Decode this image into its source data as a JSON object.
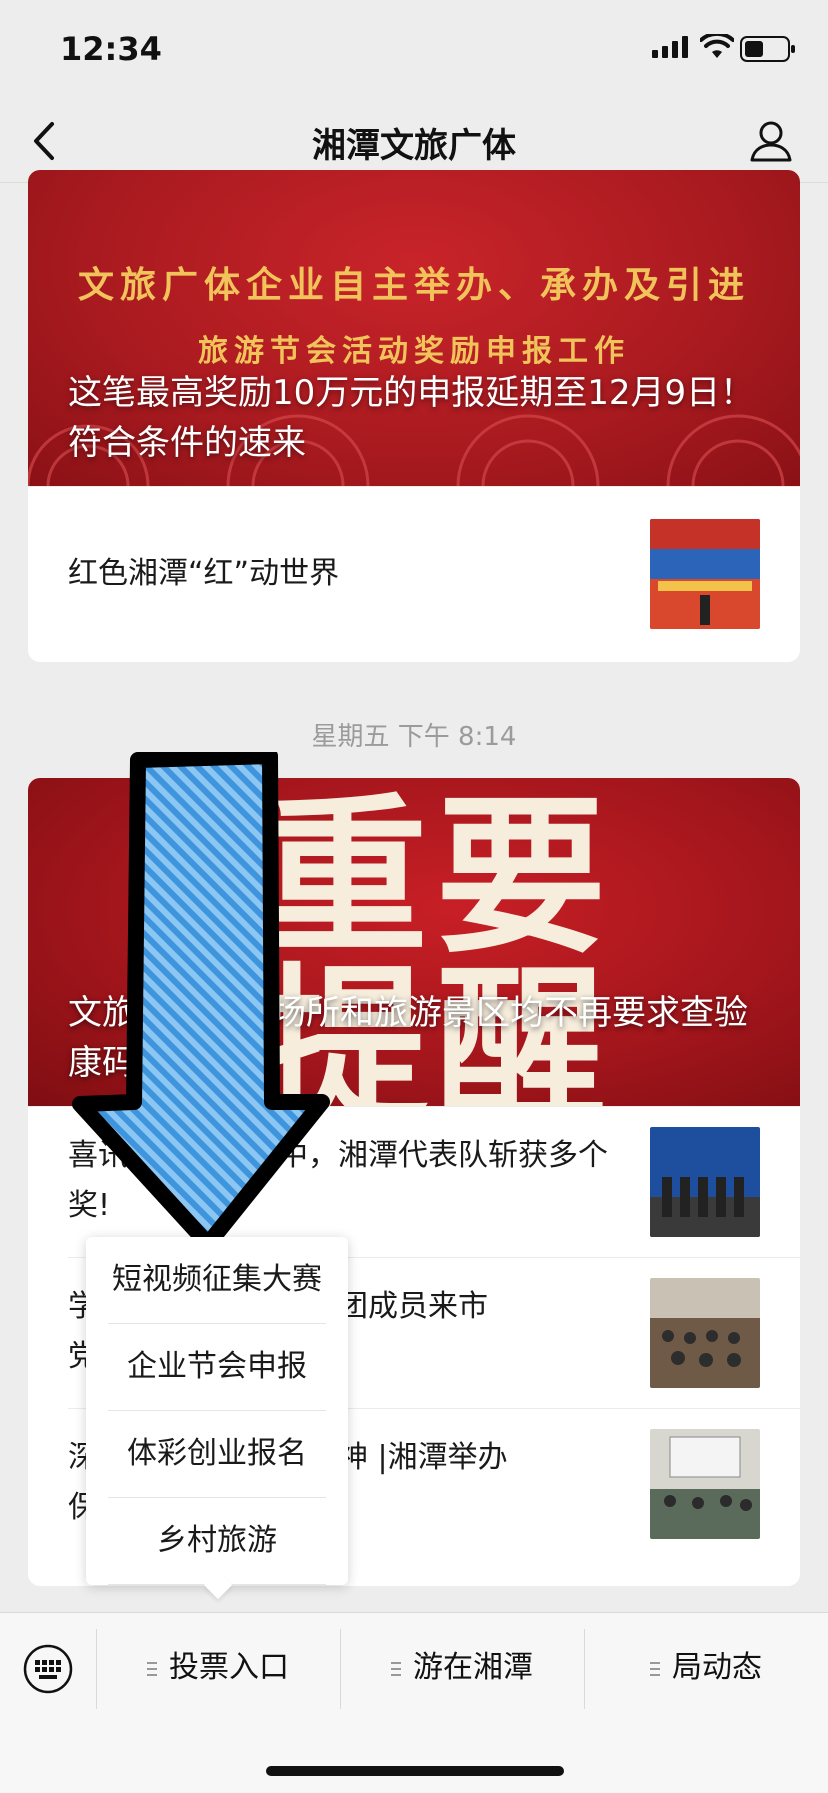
{
  "status_bar": {
    "time": "12:34"
  },
  "nav": {
    "title": "湘潭文旅广体"
  },
  "feed": {
    "card1": {
      "banner_gold_line1": "文旅广体企业自主举办、承办及引进",
      "banner_gold_line2": "旅游节会活动奖励申报工作",
      "banner_caption": "这笔最高奖励10万元的申报延期至12月9日！符合条件的速来",
      "items": [
        {
          "title": "红色湘潭“红”动世界"
        }
      ]
    },
    "time_label": "星期五 下午 8:14",
    "card2": {
      "banner_big_line1": "重要",
      "banner_big_line2": "提醒",
      "banner_caption": "文旅　　　乐场所和旅游景区均不再要求查验　　　康码",
      "items": [
        {
          "title": "喜讯　　　竞赛中，湘潭代表队斩获多个　　　奖!"
        },
        {
          "title": "学　　　　市委宣讲团成员来市　　　　党的二十大精神"
        },
        {
          "title": "深　　　　二十大精神 |湘潭举办　　　　保护工作暨非遗..."
        }
      ]
    }
  },
  "popup_menu": {
    "items": [
      "短视频征集大赛",
      "企业节会申报",
      "体彩创业报名",
      "乡村旅游"
    ]
  },
  "bottom_menu": {
    "items": [
      "投票入口",
      "游在湘潭",
      "局动态"
    ]
  },
  "colors": {
    "banner_red": "#a81a1f",
    "gold": "#f1c35b",
    "arrow_blue": "#5aa8e6"
  }
}
